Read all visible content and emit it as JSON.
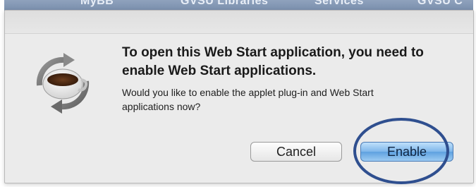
{
  "background": {
    "toolbar_items": [
      "MyBB",
      "GVSU Libraries",
      "Services",
      "GVSU C"
    ]
  },
  "dialog": {
    "title": "To open this Web Start application, you need to enable Web Start applications.",
    "message": "Would you like to enable the applet plug-in and Web Start applications now?",
    "icon": "java-coffee-cup-icon",
    "buttons": {
      "cancel_label": "Cancel",
      "enable_label": "Enable"
    }
  },
  "colors": {
    "default_button": "#7fb6ea",
    "annotation_ellipse": "#2f4f8f"
  }
}
